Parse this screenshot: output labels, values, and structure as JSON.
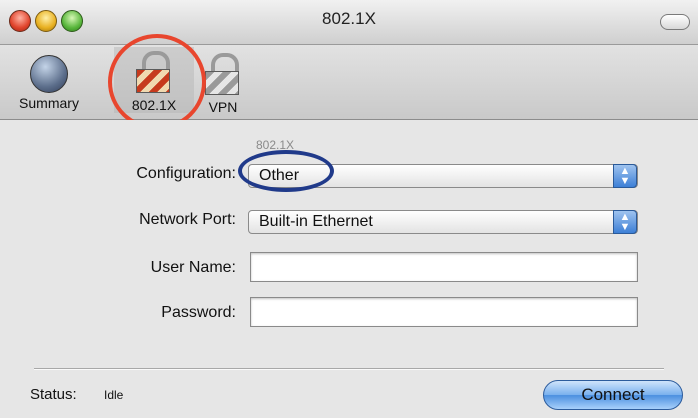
{
  "window": {
    "title": "802.1X"
  },
  "toolbar": {
    "items": [
      {
        "label": "Summary",
        "icon": "globe-icon"
      },
      {
        "label": "802.1X",
        "icon": "lock-icon",
        "selected": true
      },
      {
        "label": "VPN",
        "icon": "lock-icon"
      }
    ]
  },
  "form": {
    "section_label": "802.1X",
    "configuration_label": "Configuration:",
    "configuration_value": "Other",
    "network_port_label": "Network Port:",
    "network_port_value": "Built-in Ethernet",
    "user_name_label": "User Name:",
    "user_name_value": "",
    "password_label": "Password:",
    "password_value": ""
  },
  "status": {
    "label": "Status:",
    "value": "Idle"
  },
  "actions": {
    "connect_label": "Connect"
  },
  "colors": {
    "red_annotation": "#e8462e",
    "blue_annotation": "#203a8a",
    "connect_button": "#4b8fe0"
  }
}
